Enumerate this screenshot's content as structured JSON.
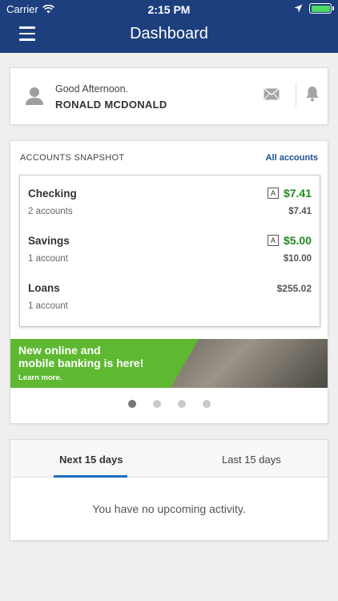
{
  "status_bar": {
    "carrier": "Carrier",
    "time": "2:15 PM"
  },
  "header": {
    "title": "Dashboard"
  },
  "greeting": {
    "line": "Good Afternoon.",
    "name": "RONALD MCDONALD"
  },
  "snapshot": {
    "title": "ACCOUNTS SNAPSHOT",
    "all_link": "All accounts",
    "accounts": [
      {
        "name": "Checking",
        "count": "2 accounts",
        "badge": "A",
        "primary_amount": "$7.41",
        "secondary_amount": "$7.41"
      },
      {
        "name": "Savings",
        "count": "1 account",
        "badge": "A",
        "primary_amount": "$5.00",
        "secondary_amount": "$10.00"
      },
      {
        "name": "Loans",
        "count": "1 account",
        "primary_amount": "$255.02"
      }
    ]
  },
  "banner": {
    "line1": "New online and",
    "line2": "mobile banking is here!",
    "cta": "Learn more."
  },
  "carousel": {
    "active_index": 0,
    "total": 4
  },
  "activity": {
    "tabs": [
      "Next 15 days",
      "Last 15 days"
    ],
    "active_tab": 0,
    "empty_message": "You have no upcoming activity."
  },
  "colors": {
    "header": "#1d3f7e",
    "positive_amount": "#1f8a1f",
    "link": "#1d4f91",
    "banner_green": "#5fb832",
    "tab_underline": "#1d6fc2"
  }
}
